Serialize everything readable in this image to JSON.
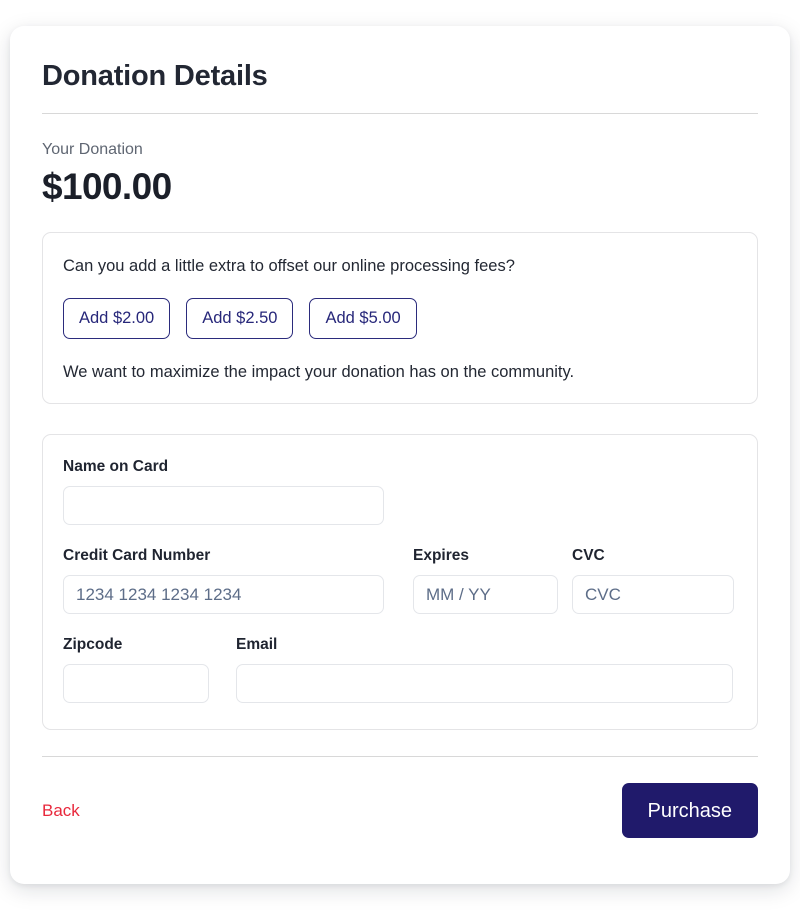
{
  "header": {
    "title": "Donation Details"
  },
  "summary": {
    "label": "Your Donation",
    "amount": "$100.00"
  },
  "fee_offset": {
    "question": "Can you add a little extra to offset our online processing fees?",
    "options": [
      {
        "label": "Add $2.00"
      },
      {
        "label": "Add $2.50"
      },
      {
        "label": "Add $5.00"
      }
    ],
    "note": "We want to maximize the impact your donation has on the community."
  },
  "payment_form": {
    "name_on_card": {
      "label": "Name on Card",
      "value": "",
      "placeholder": ""
    },
    "credit_card_number": {
      "label": "Credit Card Number",
      "value": "",
      "placeholder": "1234 1234 1234 1234"
    },
    "expires": {
      "label": "Expires",
      "value": "",
      "placeholder": "MM / YY"
    },
    "cvc": {
      "label": "CVC",
      "value": "",
      "placeholder": "CVC"
    },
    "zipcode": {
      "label": "Zipcode",
      "value": "",
      "placeholder": ""
    },
    "email": {
      "label": "Email",
      "value": "",
      "placeholder": ""
    }
  },
  "footer": {
    "back_label": "Back",
    "purchase_label": "Purchase"
  },
  "colors": {
    "accent_navy": "#201a6b",
    "option_border": "#2b2b7c",
    "back_red": "#e8283c",
    "placeholder": "#5d6d88",
    "panel_border": "#e4e4e6",
    "text_dark": "#1b1f29",
    "text_muted": "#5f6672"
  }
}
